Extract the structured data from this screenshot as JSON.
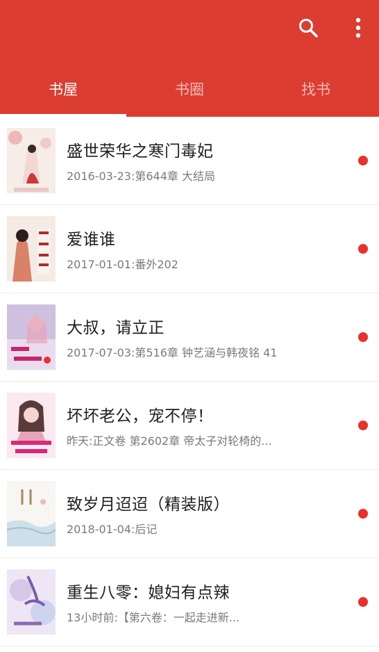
{
  "colors": {
    "accent": "#dc3d31",
    "unread_dot": "#e8312a"
  },
  "toolbar": {
    "search_icon": "search-icon",
    "more_icon": "more-vertical-icon"
  },
  "tabs": [
    {
      "label": "书屋",
      "active": true
    },
    {
      "label": "书圈",
      "active": false
    },
    {
      "label": "找书",
      "active": false
    }
  ],
  "books": [
    {
      "title": "盛世荣华之寒门毒妃",
      "latest": "2016-03-23:第644章 大结局",
      "unread": true
    },
    {
      "title": "爱谁谁",
      "latest": "2017-01-01:番外202",
      "unread": true
    },
    {
      "title": "大叔，请立正",
      "latest": "2017-07-03:第516章 钟艺涵与韩夜铭 41",
      "unread": true
    },
    {
      "title": "坏坏老公，宠不停！",
      "latest": "昨天:正文卷 第2602章 帝太子对轮椅的...",
      "unread": true
    },
    {
      "title": "致岁月迢迢（精装版）",
      "latest": "2018-01-04:后记",
      "unread": true
    },
    {
      "title": "重生八零：媳妇有点辣",
      "latest": "13小时前:【第六卷：一起走进新...",
      "unread": true
    }
  ]
}
